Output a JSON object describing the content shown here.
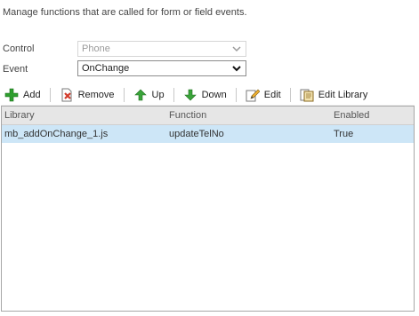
{
  "description": "Manage functions that are called for form or field events.",
  "form": {
    "control_label": "Control",
    "control_value": "Phone",
    "event_label": "Event",
    "event_value": "OnChange"
  },
  "toolbar": {
    "add_label": "Add",
    "remove_label": "Remove",
    "up_label": "Up",
    "down_label": "Down",
    "edit_label": "Edit",
    "edit_library_label": "Edit Library"
  },
  "grid": {
    "columns": [
      "Library",
      "Function",
      "Enabled"
    ],
    "rows": [
      [
        "mb_addOnChange_1.js",
        "updateTelNo",
        "True"
      ]
    ]
  },
  "colors": {
    "selected_row": "#cde6f7",
    "header_bg": "#e6e6e6",
    "add_green": "#2e9e2e",
    "remove_red": "#d23a2a"
  }
}
